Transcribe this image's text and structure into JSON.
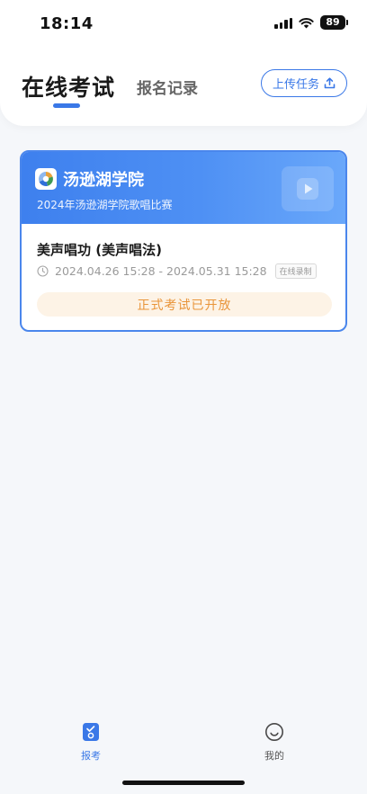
{
  "status_bar": {
    "time": "18:14",
    "battery": "89",
    "icons": [
      "signal-icon",
      "wifi-icon",
      "battery-icon"
    ]
  },
  "header": {
    "active_tab": "在线考试",
    "tab_second": "报名记录",
    "upload_button": "上传任务",
    "upload_icon": "upload-icon"
  },
  "card": {
    "school_name": "汤逊湖学院",
    "contest_name": "2024年汤逊湖学院歌唱比赛",
    "exam_title": "美声唱功 (美声唱法)",
    "exam_time": "2024.04.26 15:28 - 2024.05.31 15:28",
    "record_tag": "在线录制",
    "status": "正式考试已开放",
    "icons": [
      "school-logo-icon",
      "play-icon",
      "clock-icon"
    ]
  },
  "bottom_nav": {
    "items": [
      {
        "label": "报考",
        "icon": "exam-clipboard-icon",
        "active": true
      },
      {
        "label": "我的",
        "icon": "smiley-profile-icon",
        "active": false
      }
    ]
  },
  "colors": {
    "accent": "#3a78e7",
    "status_text": "#e9953a",
    "status_bg": "#fdf3e6",
    "banner_start": "#3e80ee",
    "banner_end": "#6aa8fa"
  }
}
